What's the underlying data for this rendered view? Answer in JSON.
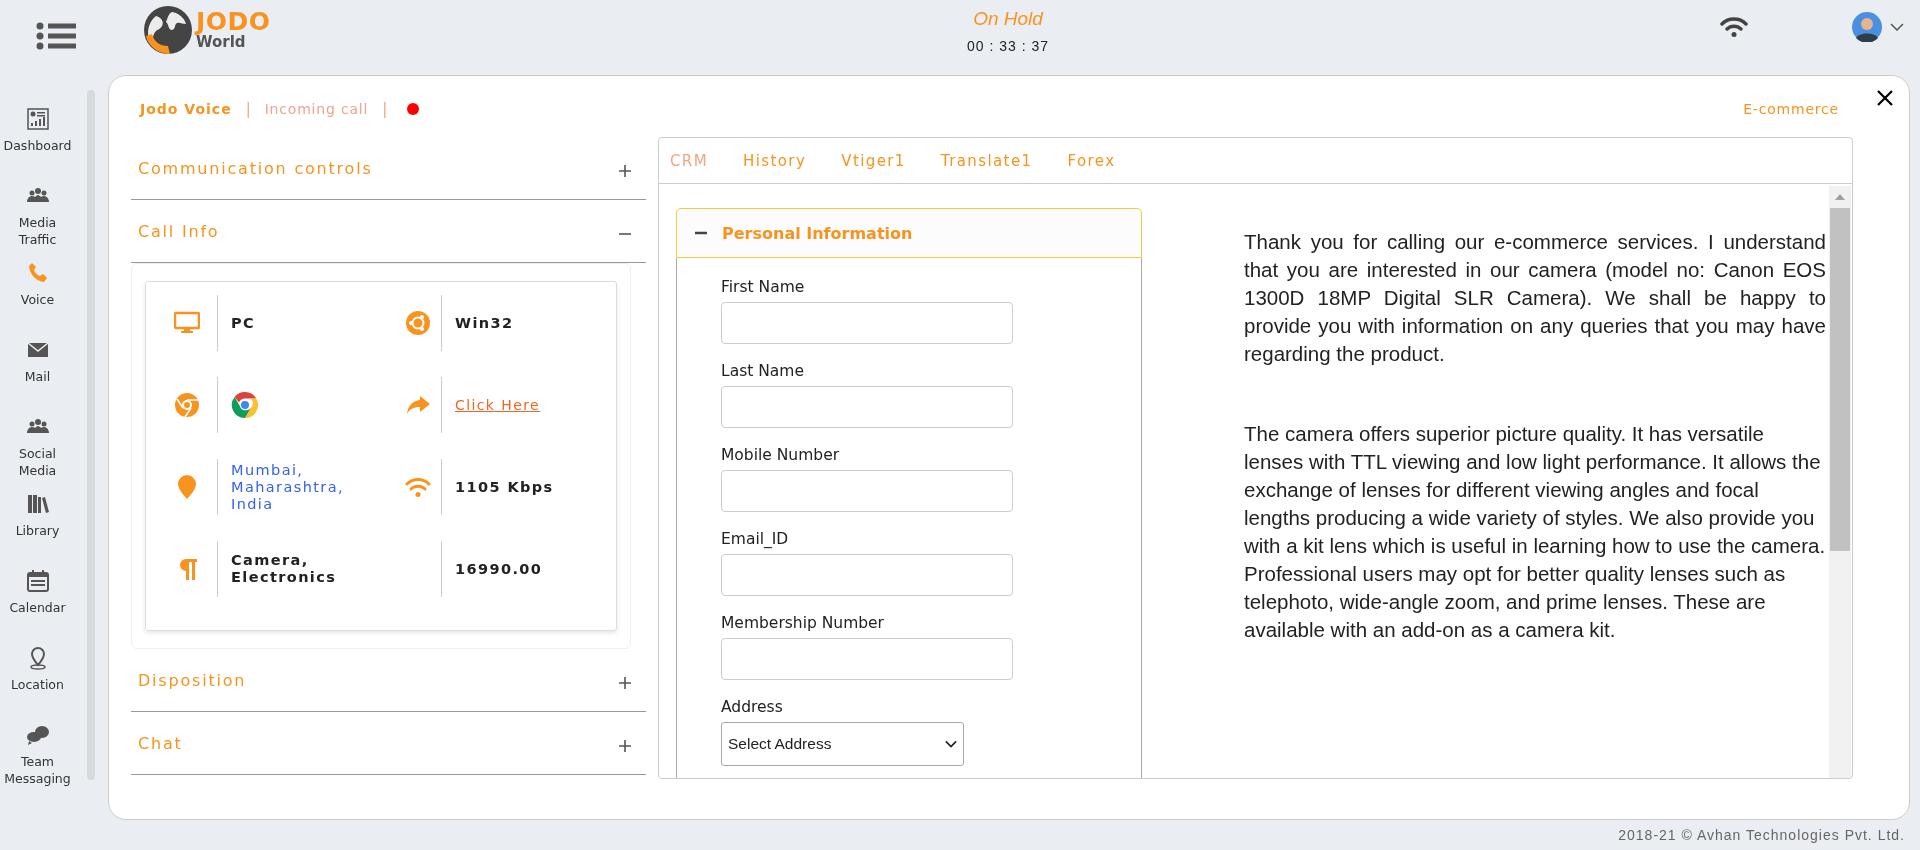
{
  "header": {
    "logo": {
      "name": "JODO",
      "tagline": "World"
    },
    "call_status": "On Hold",
    "timer": "00 : 33 : 37"
  },
  "sidebar": {
    "items": [
      {
        "label": "Dashboard",
        "selected": false
      },
      {
        "label": "Media Traffic",
        "selected": false
      },
      {
        "label": "Voice",
        "selected": true
      },
      {
        "label": "Mail",
        "selected": false
      },
      {
        "label": "Social Media",
        "selected": false
      },
      {
        "label": "Library",
        "selected": false
      },
      {
        "label": "Calendar",
        "selected": false
      },
      {
        "label": "Location",
        "selected": false
      },
      {
        "label": "Team Messaging",
        "selected": false
      }
    ]
  },
  "panel": {
    "title": "Jodo Voice",
    "separator_1": "|",
    "subtitle": "Incoming call",
    "separator_2": "|",
    "status_dot": {
      "color": "#ff0000"
    },
    "category": "E-commerce"
  },
  "sections": [
    {
      "title": "Communication controls",
      "expanded": false
    },
    {
      "title": "Call Info",
      "expanded": true
    },
    {
      "title": "Disposition",
      "expanded": false
    },
    {
      "title": "Chat",
      "expanded": false
    }
  ],
  "call_info": {
    "rows": [
      {
        "cells": [
          {
            "kind": "text",
            "value": "PC"
          },
          {
            "kind": "text",
            "value": "Win32"
          }
        ]
      },
      {
        "cells": [
          {
            "kind": "browser"
          },
          {
            "kind": "link",
            "value": "Click Here"
          }
        ]
      },
      {
        "cells": [
          {
            "kind": "place",
            "value": "Mumbai, Maharashtra, India"
          },
          {
            "kind": "text",
            "value": "1105 Kbps"
          }
        ]
      },
      {
        "cells": [
          {
            "kind": "text",
            "value": "Camera, Electronics"
          },
          {
            "kind": "text",
            "value": "16990.00"
          }
        ]
      }
    ]
  },
  "tabs": [
    {
      "label": "CRM",
      "selected": true
    },
    {
      "label": "History",
      "selected": false
    },
    {
      "label": "Vtiger1",
      "selected": false
    },
    {
      "label": "Translate1",
      "selected": false
    },
    {
      "label": "Forex",
      "selected": false
    }
  ],
  "form": {
    "title": "Personal Information",
    "expanded": true,
    "fields": [
      {
        "kind": "input",
        "label": "First Name"
      },
      {
        "kind": "input",
        "label": "Last Name"
      },
      {
        "kind": "input",
        "label": "Mobile Number"
      },
      {
        "kind": "input",
        "label": "Email_ID"
      },
      {
        "kind": "input",
        "label": "Membership Number"
      },
      {
        "kind": "select",
        "label": "Address",
        "value": "Select Address"
      }
    ]
  },
  "script": {
    "paragraphs": [
      {
        "kind": "justified",
        "text": "Thank you for calling our e-commerce services. I understand that you are interested in our camera (model no: Canon EOS 1300D 18MP Digital SLR Camera). We shall be happy to provide you with information on any queries that you may have regarding the product."
      },
      {
        "kind": "plain",
        "text": "The camera offers superior picture quality. It has versatile lenses with TTL viewing and low light performance. It allows the exchange of lenses for different viewing angles and focal lengths producing a wide variety of styles. We also provide you with a kit lens which is useful in learning how to use the camera. Professional users may opt for better quality lenses such as telephoto, wide-angle zoom, and prime lenses. These are available with an add-on as a camera kit."
      }
    ]
  },
  "footer": "2018-21 © Avhan Technologies Pvt. Ltd."
}
